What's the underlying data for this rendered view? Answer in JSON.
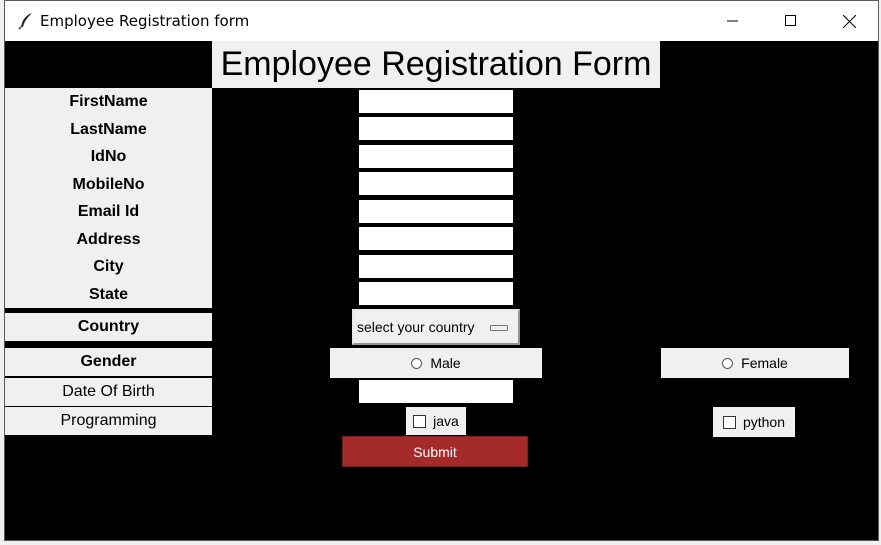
{
  "window": {
    "title": "Employee Registration form",
    "icon": "feather-icon",
    "controls": [
      "minimize-icon",
      "maximize-icon",
      "close-icon"
    ]
  },
  "form": {
    "heading": "Employee Registration Form",
    "labels": {
      "firstname": "FirstName",
      "lastname": "LastName",
      "idno": "IdNo",
      "mobileno": "MobileNo",
      "email": "Email Id",
      "address": "Address",
      "city": "City",
      "state": "State",
      "country": "Country",
      "gender": "Gender",
      "dob": "Date Of Birth",
      "programming": "Programming"
    },
    "fields": {
      "firstname": "",
      "lastname": "",
      "idno": "",
      "mobileno": "",
      "email": "",
      "address": "",
      "city": "",
      "state": "",
      "dob": ""
    },
    "country_select": "select your country",
    "gender_options": {
      "male": "Male",
      "female": "Female"
    },
    "programming_options": {
      "java": "java",
      "python": "python"
    },
    "submit_label": "Submit"
  },
  "colors": {
    "background": "#000000",
    "panel": "#f0f0f0",
    "submit": "#a52a2a"
  }
}
